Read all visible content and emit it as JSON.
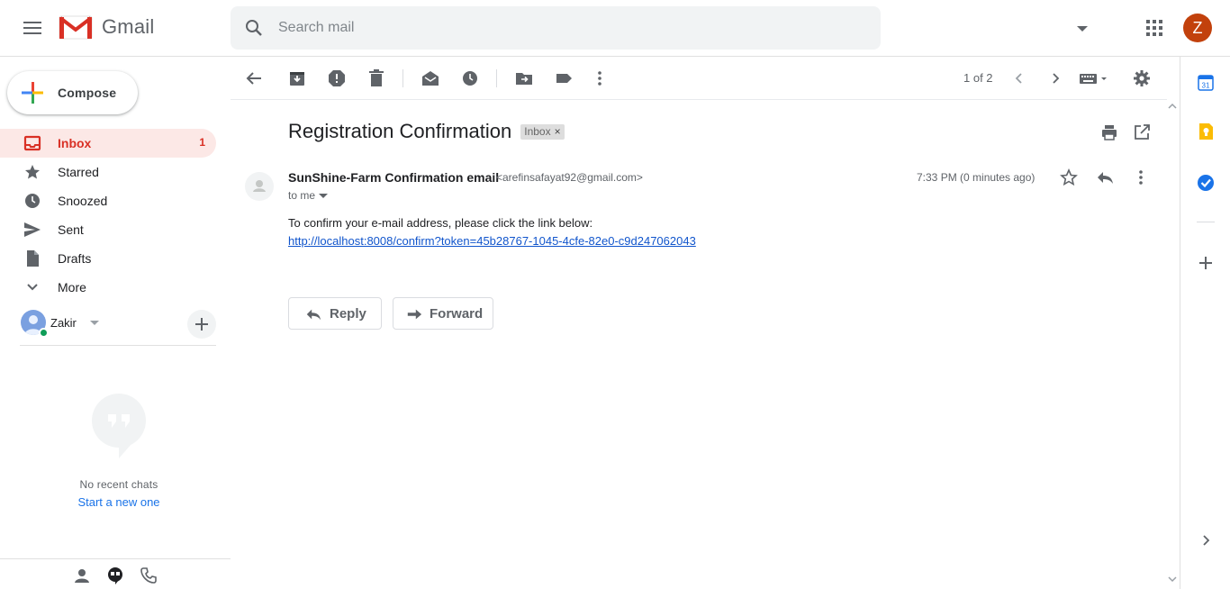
{
  "app": {
    "logo_text": "Gmail",
    "brand_color": "#d93025"
  },
  "header": {
    "search_placeholder": "Search mail",
    "avatar_initial": "Z",
    "avatar_color": "#c2410c"
  },
  "sidebar": {
    "compose_label": "Compose",
    "items": [
      {
        "label": "Inbox",
        "count": "1",
        "icon": "inbox-icon",
        "active": true
      },
      {
        "label": "Starred",
        "count": "",
        "icon": "star-icon"
      },
      {
        "label": "Snoozed",
        "count": "",
        "icon": "clock-icon"
      },
      {
        "label": "Sent",
        "count": "",
        "icon": "send-icon"
      },
      {
        "label": "Drafts",
        "count": "",
        "icon": "draft-icon"
      },
      {
        "label": "More",
        "count": "",
        "icon": "chevron-down-icon"
      }
    ],
    "hangouts_user": "Zakir",
    "no_chats": "No recent chats",
    "start_new": "Start a new one"
  },
  "toolbar": {
    "paging": "1 of 2"
  },
  "message": {
    "subject": "Registration Confirmation",
    "label": "Inbox",
    "sender_name": "SunShine-Farm Confirmation email",
    "sender_email": "<arefinsafayat92@gmail.com>",
    "to": "to me",
    "timestamp": "7:33 PM (0 minutes ago)",
    "body_line": "To confirm your e-mail address, please click the link below:",
    "link": "http://localhost:8008/confirm?token=45b28767-1045-4cfe-82e0-c9d247062043",
    "reply_label": "Reply",
    "forward_label": "Forward"
  }
}
